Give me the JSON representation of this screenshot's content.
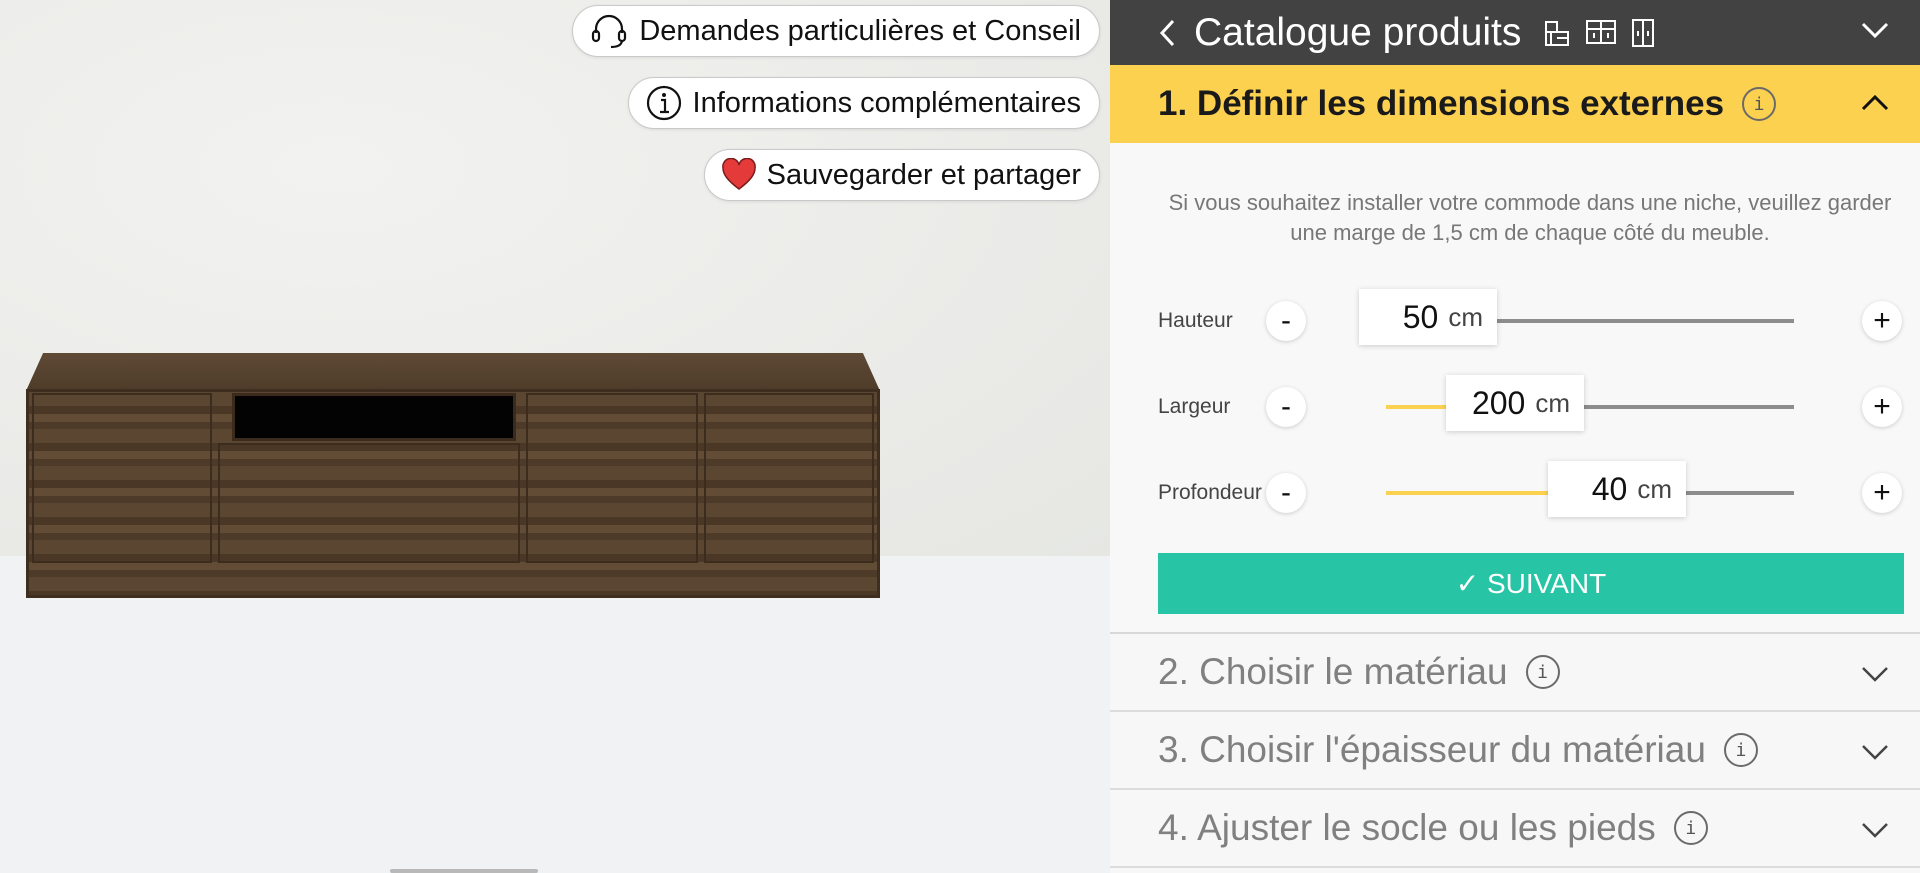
{
  "viewer": {
    "actions": [
      {
        "label": "Demandes particulières et Conseil",
        "icon": "headset-icon"
      },
      {
        "label": "Informations complémentaires",
        "icon": "info-icon"
      },
      {
        "label": "Sauvegarder et partager",
        "icon": "heart-icon"
      }
    ]
  },
  "panel": {
    "catalogue_title": "Catalogue produits",
    "steps": [
      {
        "label": "1. Définir les dimensions externes",
        "expanded": true
      },
      {
        "label": "2. Choisir le matériau",
        "expanded": false
      },
      {
        "label": "3. Choisir l'épaisseur du matériau",
        "expanded": false
      },
      {
        "label": "4. Ajuster le socle ou les pieds",
        "expanded": false
      }
    ],
    "info_glyph": "i",
    "hint": "Si vous souhaitez installer votre commode dans une niche, veuillez garder une marge de 1,5 cm de chaque côté du meuble.",
    "dimensions": [
      {
        "label": "Hauteur",
        "value": "50",
        "unit": "cm",
        "slider_fraction": 0.0
      },
      {
        "label": "Largeur",
        "value": "200",
        "unit": "cm",
        "slider_fraction": 0.22
      },
      {
        "label": "Profondeur",
        "value": "40",
        "unit": "cm",
        "slider_fraction": 0.46
      }
    ],
    "minus_label": "-",
    "plus_label": "+",
    "next_button": "✓ SUIVANT",
    "colors": {
      "accent_yellow": "#fdd150",
      "next_green": "#28c4a6",
      "header_dark": "#424242"
    }
  }
}
